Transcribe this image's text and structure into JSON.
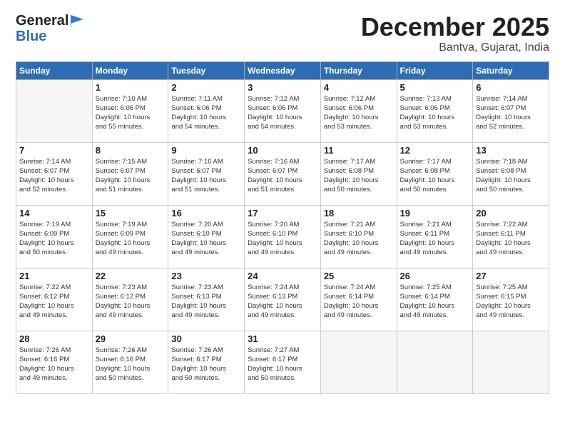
{
  "header": {
    "logo_general": "General",
    "logo_blue": "Blue",
    "title": "December 2025",
    "location": "Bantva, Gujarat, India"
  },
  "weekdays": [
    "Sunday",
    "Monday",
    "Tuesday",
    "Wednesday",
    "Thursday",
    "Friday",
    "Saturday"
  ],
  "weeks": [
    [
      {
        "day": "",
        "info": ""
      },
      {
        "day": "1",
        "info": "Sunrise: 7:10 AM\nSunset: 6:06 PM\nDaylight: 10 hours\nand 55 minutes."
      },
      {
        "day": "2",
        "info": "Sunrise: 7:11 AM\nSunset: 6:06 PM\nDaylight: 10 hours\nand 54 minutes."
      },
      {
        "day": "3",
        "info": "Sunrise: 7:12 AM\nSunset: 6:06 PM\nDaylight: 10 hours\nand 54 minutes."
      },
      {
        "day": "4",
        "info": "Sunrise: 7:12 AM\nSunset: 6:06 PM\nDaylight: 10 hours\nand 53 minutes."
      },
      {
        "day": "5",
        "info": "Sunrise: 7:13 AM\nSunset: 6:06 PM\nDaylight: 10 hours\nand 53 minutes."
      },
      {
        "day": "6",
        "info": "Sunrise: 7:14 AM\nSunset: 6:07 PM\nDaylight: 10 hours\nand 52 minutes."
      }
    ],
    [
      {
        "day": "7",
        "info": "Sunrise: 7:14 AM\nSunset: 6:07 PM\nDaylight: 10 hours\nand 52 minutes."
      },
      {
        "day": "8",
        "info": "Sunrise: 7:15 AM\nSunset: 6:07 PM\nDaylight: 10 hours\nand 51 minutes."
      },
      {
        "day": "9",
        "info": "Sunrise: 7:16 AM\nSunset: 6:07 PM\nDaylight: 10 hours\nand 51 minutes."
      },
      {
        "day": "10",
        "info": "Sunrise: 7:16 AM\nSunset: 6:07 PM\nDaylight: 10 hours\nand 51 minutes."
      },
      {
        "day": "11",
        "info": "Sunrise: 7:17 AM\nSunset: 6:08 PM\nDaylight: 10 hours\nand 50 minutes."
      },
      {
        "day": "12",
        "info": "Sunrise: 7:17 AM\nSunset: 6:08 PM\nDaylight: 10 hours\nand 50 minutes."
      },
      {
        "day": "13",
        "info": "Sunrise: 7:18 AM\nSunset: 6:08 PM\nDaylight: 10 hours\nand 50 minutes."
      }
    ],
    [
      {
        "day": "14",
        "info": "Sunrise: 7:19 AM\nSunset: 6:09 PM\nDaylight: 10 hours\nand 50 minutes."
      },
      {
        "day": "15",
        "info": "Sunrise: 7:19 AM\nSunset: 6:09 PM\nDaylight: 10 hours\nand 49 minutes."
      },
      {
        "day": "16",
        "info": "Sunrise: 7:20 AM\nSunset: 6:10 PM\nDaylight: 10 hours\nand 49 minutes."
      },
      {
        "day": "17",
        "info": "Sunrise: 7:20 AM\nSunset: 6:10 PM\nDaylight: 10 hours\nand 49 minutes."
      },
      {
        "day": "18",
        "info": "Sunrise: 7:21 AM\nSunset: 6:10 PM\nDaylight: 10 hours\nand 49 minutes."
      },
      {
        "day": "19",
        "info": "Sunrise: 7:21 AM\nSunset: 6:11 PM\nDaylight: 10 hours\nand 49 minutes."
      },
      {
        "day": "20",
        "info": "Sunrise: 7:22 AM\nSunset: 6:11 PM\nDaylight: 10 hours\nand 49 minutes."
      }
    ],
    [
      {
        "day": "21",
        "info": "Sunrise: 7:22 AM\nSunset: 6:12 PM\nDaylight: 10 hours\nand 49 minutes."
      },
      {
        "day": "22",
        "info": "Sunrise: 7:23 AM\nSunset: 6:12 PM\nDaylight: 10 hours\nand 49 minutes."
      },
      {
        "day": "23",
        "info": "Sunrise: 7:23 AM\nSunset: 6:13 PM\nDaylight: 10 hours\nand 49 minutes."
      },
      {
        "day": "24",
        "info": "Sunrise: 7:24 AM\nSunset: 6:13 PM\nDaylight: 10 hours\nand 49 minutes."
      },
      {
        "day": "25",
        "info": "Sunrise: 7:24 AM\nSunset: 6:14 PM\nDaylight: 10 hours\nand 49 minutes."
      },
      {
        "day": "26",
        "info": "Sunrise: 7:25 AM\nSunset: 6:14 PM\nDaylight: 10 hours\nand 49 minutes."
      },
      {
        "day": "27",
        "info": "Sunrise: 7:25 AM\nSunset: 6:15 PM\nDaylight: 10 hours\nand 49 minutes."
      }
    ],
    [
      {
        "day": "28",
        "info": "Sunrise: 7:26 AM\nSunset: 6:16 PM\nDaylight: 10 hours\nand 49 minutes."
      },
      {
        "day": "29",
        "info": "Sunrise: 7:26 AM\nSunset: 6:16 PM\nDaylight: 10 hours\nand 50 minutes."
      },
      {
        "day": "30",
        "info": "Sunrise: 7:26 AM\nSunset: 6:17 PM\nDaylight: 10 hours\nand 50 minutes."
      },
      {
        "day": "31",
        "info": "Sunrise: 7:27 AM\nSunset: 6:17 PM\nDaylight: 10 hours\nand 50 minutes."
      },
      {
        "day": "",
        "info": ""
      },
      {
        "day": "",
        "info": ""
      },
      {
        "day": "",
        "info": ""
      }
    ]
  ]
}
